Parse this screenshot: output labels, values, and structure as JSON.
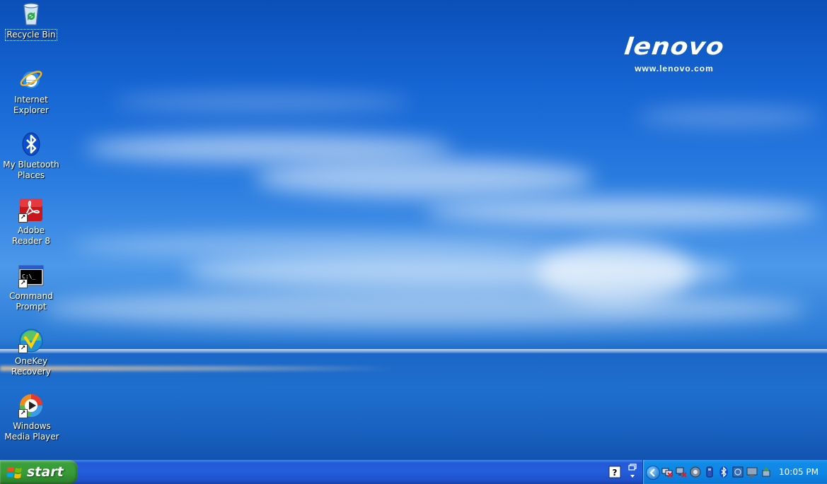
{
  "desktop": {
    "icons": [
      {
        "label": "Recycle Bin"
      },
      {
        "label": "Internet Explorer"
      },
      {
        "label": "My Bluetooth Places"
      },
      {
        "label": "Adobe Reader 8"
      },
      {
        "label": "Command Prompt"
      },
      {
        "label": "OneKey Recovery"
      },
      {
        "label": "Windows Media Player"
      }
    ],
    "selected_icon": "Recycle Bin"
  },
  "wallpaper": {
    "brand": "lenovo",
    "url": "www.lenovo.com"
  },
  "taskbar": {
    "start_label": "start",
    "tray_icons": [
      "help-icon",
      "restore-icon",
      "chevron-left-icon",
      "network-disconnected-icon",
      "network-disconnected-icon",
      "speaker-icon",
      "battery-icon",
      "bluetooth-icon",
      "display-icon",
      "monitor-icon",
      "safely-remove-hardware-icon"
    ],
    "clock": "10:05 PM"
  },
  "colors": {
    "taskbar": "#245edb",
    "start_button": "#379b37",
    "tray": "#0f85e4"
  }
}
